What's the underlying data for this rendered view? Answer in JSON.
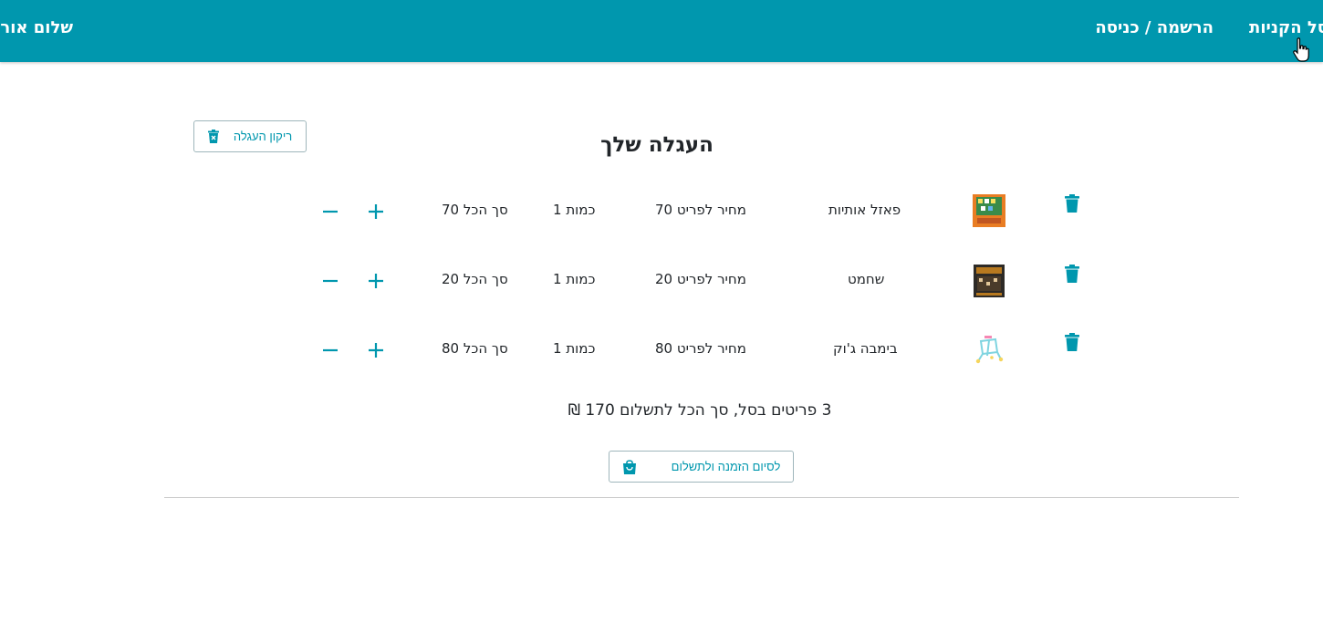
{
  "nav": {
    "cart_label": "סל הקניות",
    "register_label": "הרשמה / כניסה",
    "greeting": "שלום אורח"
  },
  "cart": {
    "title": "העגלה שלך",
    "clear_label": "ריקון העגלה",
    "items": [
      {
        "name": "פאזל אותיות",
        "price_label": "מחיר לפריט 70",
        "qty_label": "כמות 1",
        "total_label": "סך הכל 70",
        "price": 70,
        "qty": 1,
        "total": 70
      },
      {
        "name": "שחמט",
        "price_label": "מחיר לפריט 20",
        "qty_label": "כמות 1",
        "total_label": "סך הכל 20",
        "price": 20,
        "qty": 1,
        "total": 20
      },
      {
        "name": "בימבה ג'וק",
        "price_label": "מחיר לפריט 80",
        "qty_label": "כמות 1",
        "total_label": "סך הכל 80",
        "price": 80,
        "qty": 1,
        "total": 80
      }
    ],
    "summary": "3 פריטים בסל, סך הכל לתשלום 170 ₪",
    "checkout_label": "לסיום הזמנה ולתשלום"
  },
  "colors": {
    "brand": "#0097ae",
    "white": "#ffffff",
    "text": "#212529"
  },
  "icons": {
    "trash": "trash-icon",
    "clear_cart": "trash-x-icon",
    "bag": "shopping-bag-icon",
    "plus": "plus-icon",
    "minus": "minus-icon"
  }
}
